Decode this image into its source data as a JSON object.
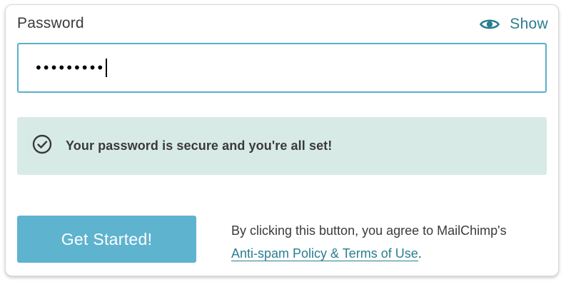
{
  "password": {
    "label": "Password",
    "show_label": "Show",
    "masked_value": "•••••••••"
  },
  "status": {
    "message": "Your password is secure and you're all set!"
  },
  "cta": {
    "button_label": "Get Started!",
    "agreement_text": "By clicking this button, you agree to MailChimp's",
    "link_text": "Anti-spam Policy & Terms of Use",
    "trailing": "."
  },
  "icons": {
    "show": "eye-icon",
    "status": "check-circle-icon"
  },
  "colors": {
    "accent_text": "#2a7d91",
    "input_border": "#5aafcb",
    "success_bg": "#d8eae6",
    "button_bg": "#5eb3cf",
    "button_text": "#ffffff"
  }
}
